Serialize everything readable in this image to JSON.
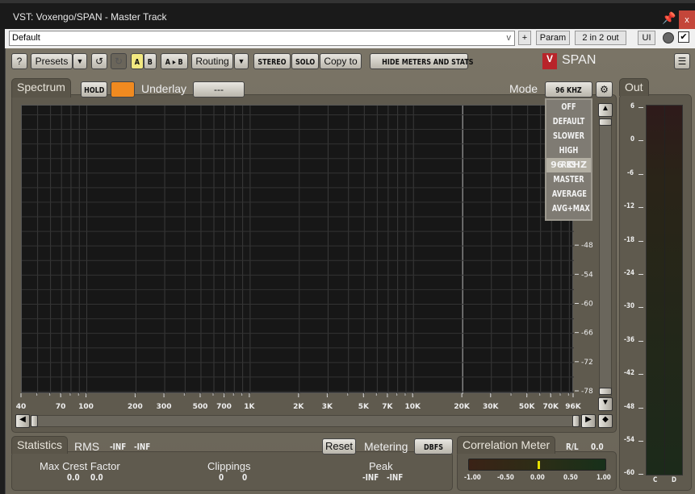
{
  "window": {
    "title": "VST: Voxengo/SPAN - Master Track",
    "close": "x",
    "pin_icon": "pin-icon"
  },
  "host": {
    "preset": "Default",
    "plus": "+",
    "param": "Param",
    "io": "2 in 2 out",
    "ui": "UI",
    "enabled": true
  },
  "toolbar": {
    "help": "?",
    "presets": "Presets",
    "a": "A",
    "b": "B",
    "ab": "A ▸ B",
    "routing": "Routing",
    "stereo": "STEREO",
    "solo": "SOLO",
    "copy_to": "Copy to",
    "hide": "HIDE METERS AND STATS",
    "logo": "SPAN"
  },
  "spectrum": {
    "tab": "Spectrum",
    "hold": "HOLD",
    "underlay_label": "Underlay",
    "underlay_value": "---",
    "mode_label": "Mode",
    "mode_value": "96 KHZ",
    "mode_options": [
      "OFF",
      "DEFAULT",
      "SLOWER",
      "HIGH RES",
      "96 KHZ",
      "MASTER",
      "AVERAGE",
      "AVG+MAX"
    ],
    "mode_selected": "96 KHZ",
    "freq_labels": [
      "40",
      "70",
      "100",
      "200",
      "300",
      "500",
      "700",
      "1K",
      "2K",
      "3K",
      "5K",
      "7K",
      "10K",
      "20K",
      "30K",
      "50K",
      "70K",
      "96K"
    ],
    "freq_values": [
      40,
      70,
      100,
      200,
      300,
      500,
      700,
      1000,
      2000,
      3000,
      5000,
      7000,
      10000,
      20000,
      30000,
      50000,
      70000,
      96000
    ],
    "db_labels": [
      "-48",
      "-54",
      "-60",
      "-66",
      "-72",
      "-78"
    ],
    "db_values": [
      -48,
      -54,
      -60,
      -66,
      -72,
      -78
    ]
  },
  "stats": {
    "tab": "Statistics",
    "rms_label": "RMS",
    "rms_l": "-INF",
    "rms_r": "-INF",
    "reset": "Reset",
    "metering_label": "Metering",
    "metering_value": "DBFS",
    "crest_label": "Max Crest Factor",
    "crest_l": "0.0",
    "crest_r": "0.0",
    "clip_label": "Clippings",
    "clip_l": "0",
    "clip_r": "0",
    "peak_label": "Peak",
    "peak_l": "-INF",
    "peak_r": "-INF"
  },
  "correlation": {
    "tab": "Correlation Meter",
    "rl_label": "R/L",
    "rl_value": "0.0",
    "value": 0.0,
    "scale": [
      "-1.00",
      "-0.50",
      "0.00",
      "0.50",
      "1.00"
    ]
  },
  "out": {
    "tab": "Out",
    "scale": [
      "6",
      "0",
      "-6",
      "-12",
      "-18",
      "-24",
      "-30",
      "-36",
      "-42",
      "-48",
      "-54",
      "-60"
    ],
    "channels": [
      "C",
      "D"
    ]
  }
}
